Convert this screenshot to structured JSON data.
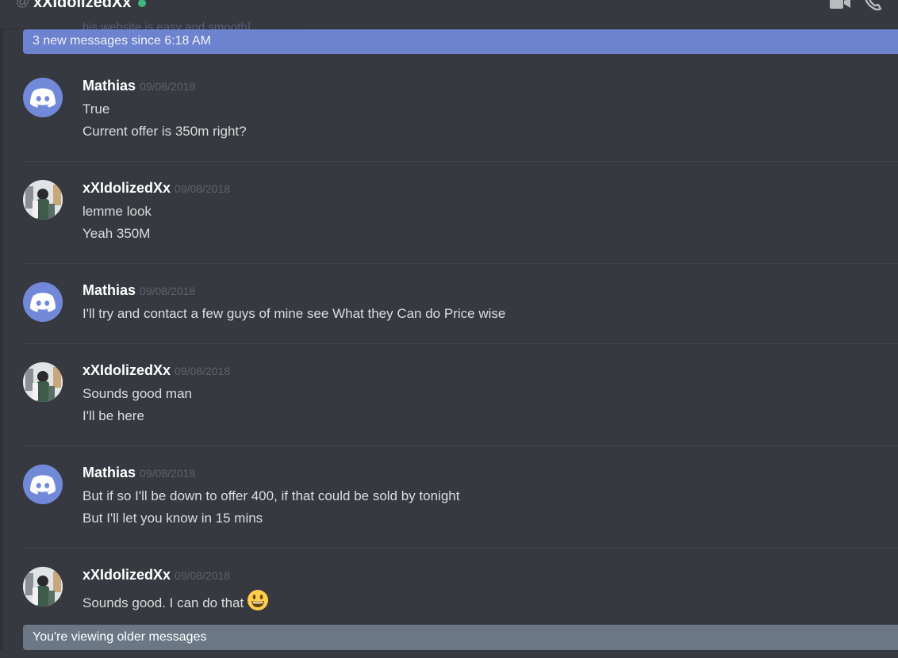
{
  "header": {
    "at_symbol": "@",
    "channel_name": "xXIdolizedXx",
    "status_color": "#43b581"
  },
  "ghost_text": "his website is easy and smooth]",
  "new_messages_bar": {
    "label": "3 new messages since 6:18 AM",
    "color": "#7289da"
  },
  "messages": [
    {
      "author": "Mathias",
      "timestamp": "09/08/2018",
      "avatar": "discord-logo",
      "lines": [
        "True",
        "Current offer is 350m right?"
      ]
    },
    {
      "author": "xXIdolizedXx",
      "timestamp": "09/08/2018",
      "avatar": "user-photo",
      "lines": [
        "lemme look",
        "Yeah 350M"
      ]
    },
    {
      "author": "Mathias",
      "timestamp": "09/08/2018",
      "avatar": "discord-logo",
      "lines": [
        "I'll try and contact a few guys of mine see What they Can do Price wise"
      ]
    },
    {
      "author": "xXIdolizedXx",
      "timestamp": "09/08/2018",
      "avatar": "user-photo",
      "lines": [
        "Sounds good man",
        "I'll be here"
      ]
    },
    {
      "author": "Mathias",
      "timestamp": "09/08/2018",
      "avatar": "discord-logo",
      "lines": [
        "But if so I'll be down to offer 400, if that could be sold by tonight",
        "But I'll let you know in 15 mins"
      ]
    },
    {
      "author": "xXIdolizedXx",
      "timestamp": "09/08/2018",
      "avatar": "user-photo",
      "lines": [
        "Sounds good. I can do that"
      ]
    }
  ],
  "older_messages_bar": {
    "label": "You're viewing older messages"
  }
}
